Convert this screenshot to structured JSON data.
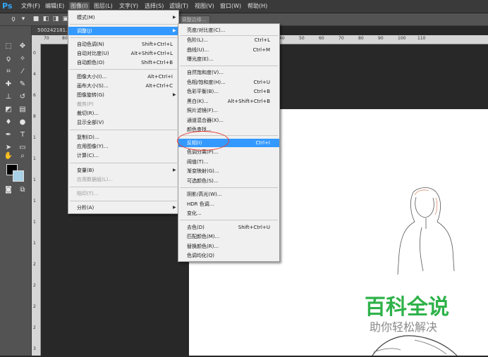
{
  "app": {
    "logo": "Ps"
  },
  "menubar": [
    {
      "label": "文件(F)",
      "active": false
    },
    {
      "label": "编辑(E)",
      "active": false
    },
    {
      "label": "图像(I)",
      "active": true
    },
    {
      "label": "图层(L)",
      "active": false
    },
    {
      "label": "文字(Y)",
      "active": false
    },
    {
      "label": "选择(S)",
      "active": false
    },
    {
      "label": "滤镜(T)",
      "active": false
    },
    {
      "label": "视图(V)",
      "active": false
    },
    {
      "label": "窗口(W)",
      "active": false
    },
    {
      "label": "帮助(H)",
      "active": false
    }
  ],
  "optionsbar": {
    "refine_edge_label": "调整边缘..."
  },
  "document": {
    "tab_label": "500242181..."
  },
  "ruler": {
    "h_labels": [
      "70",
      "80",
      "40",
      "50",
      "60",
      "70",
      "80",
      "90",
      "100",
      "110"
    ],
    "v_labels": [
      "0",
      "4",
      "6",
      "8",
      "1",
      "1",
      "1",
      "1",
      "1",
      "1",
      "2",
      "2",
      "2",
      "2",
      "3"
    ]
  },
  "image_menu": {
    "items": [
      {
        "label": "模式(M)",
        "shortcut": "",
        "submenu": true,
        "disabled": false,
        "highlight": false
      },
      {
        "label": "调整(J)",
        "shortcut": "",
        "submenu": true,
        "disabled": false,
        "highlight": true
      },
      {
        "label": "自动色调(N)",
        "shortcut": "Shift+Ctrl+L",
        "submenu": false,
        "disabled": false,
        "highlight": false
      },
      {
        "label": "自动对比度(U)",
        "shortcut": "Alt+Shift+Ctrl+L",
        "submenu": false,
        "disabled": false,
        "highlight": false
      },
      {
        "label": "自动颜色(O)",
        "shortcut": "Shift+Ctrl+B",
        "submenu": false,
        "disabled": false,
        "highlight": false
      },
      {
        "label": "图像大小(I)...",
        "shortcut": "Alt+Ctrl+I",
        "submenu": false,
        "disabled": false,
        "highlight": false
      },
      {
        "label": "画布大小(S)...",
        "shortcut": "Alt+Ctrl+C",
        "submenu": false,
        "disabled": false,
        "highlight": false
      },
      {
        "label": "图像旋转(G)",
        "shortcut": "",
        "submenu": true,
        "disabled": false,
        "highlight": false
      },
      {
        "label": "裁剪(P)",
        "shortcut": "",
        "submenu": false,
        "disabled": true,
        "highlight": false
      },
      {
        "label": "裁切(R)...",
        "shortcut": "",
        "submenu": false,
        "disabled": false,
        "highlight": false
      },
      {
        "label": "显示全部(V)",
        "shortcut": "",
        "submenu": false,
        "disabled": false,
        "highlight": false
      },
      {
        "label": "复制(D)...",
        "shortcut": "",
        "submenu": false,
        "disabled": false,
        "highlight": false
      },
      {
        "label": "应用图像(Y)...",
        "shortcut": "",
        "submenu": false,
        "disabled": false,
        "highlight": false
      },
      {
        "label": "计算(C)...",
        "shortcut": "",
        "submenu": false,
        "disabled": false,
        "highlight": false
      },
      {
        "label": "变量(B)",
        "shortcut": "",
        "submenu": true,
        "disabled": false,
        "highlight": false
      },
      {
        "label": "应用数据组(L)...",
        "shortcut": "",
        "submenu": false,
        "disabled": true,
        "highlight": false
      },
      {
        "label": "陷印(T)...",
        "shortcut": "",
        "submenu": false,
        "disabled": true,
        "highlight": false
      },
      {
        "label": "分析(A)",
        "shortcut": "",
        "submenu": true,
        "disabled": false,
        "highlight": false
      }
    ]
  },
  "adjust_menu": {
    "items": [
      {
        "label": "亮度/对比度(C)...",
        "shortcut": "",
        "highlight": false
      },
      {
        "label": "色阶(L)...",
        "shortcut": "Ctrl+L",
        "highlight": false
      },
      {
        "label": "曲线(U)...",
        "shortcut": "Ctrl+M",
        "highlight": false
      },
      {
        "label": "曝光度(E)...",
        "shortcut": "",
        "highlight": false
      },
      {
        "label": "自然饱和度(V)...",
        "shortcut": "",
        "highlight": false
      },
      {
        "label": "色相/饱和度(H)...",
        "shortcut": "Ctrl+U",
        "highlight": false
      },
      {
        "label": "色彩平衡(B)...",
        "shortcut": "Ctrl+B",
        "highlight": false
      },
      {
        "label": "黑白(K)...",
        "shortcut": "Alt+Shift+Ctrl+B",
        "highlight": false
      },
      {
        "label": "照片滤镜(F)...",
        "shortcut": "",
        "highlight": false
      },
      {
        "label": "通道混合器(X)...",
        "shortcut": "",
        "highlight": false
      },
      {
        "label": "颜色查找...",
        "shortcut": "",
        "highlight": false
      },
      {
        "label": "反相(I)",
        "shortcut": "Ctrl+I",
        "highlight": true
      },
      {
        "label": "色调分离(P)...",
        "shortcut": "",
        "highlight": false
      },
      {
        "label": "阈值(T)...",
        "shortcut": "",
        "highlight": false
      },
      {
        "label": "渐变映射(G)...",
        "shortcut": "",
        "highlight": false
      },
      {
        "label": "可选颜色(S)...",
        "shortcut": "",
        "highlight": false
      },
      {
        "label": "阴影/高光(W)...",
        "shortcut": "",
        "highlight": false
      },
      {
        "label": "HDR 色调...",
        "shortcut": "",
        "highlight": false
      },
      {
        "label": "变化...",
        "shortcut": "",
        "highlight": false
      },
      {
        "label": "去色(D)",
        "shortcut": "Shift+Ctrl+U",
        "highlight": false
      },
      {
        "label": "匹配颜色(M)...",
        "shortcut": "",
        "highlight": false
      },
      {
        "label": "替换颜色(R)...",
        "shortcut": "",
        "highlight": false
      },
      {
        "label": "色调均化(Q)",
        "shortcut": "",
        "highlight": false
      }
    ]
  },
  "watermark": {
    "title": "百科全说",
    "subtitle": "助你轻松解决"
  },
  "colors": {
    "accent": "#3399ff",
    "highlight_ring": "#e53935",
    "watermark_green": "#2fb24a",
    "ps_blue": "#31a8ff"
  },
  "icons": [
    "lasso-icon",
    "move-icon",
    "marquee-icon",
    "magic-wand-icon",
    "crop-icon",
    "eyedropper-icon",
    "healing-brush-icon",
    "brush-icon",
    "clone-stamp-icon",
    "history-brush-icon",
    "eraser-icon",
    "gradient-icon",
    "blur-icon",
    "dodge-icon",
    "pen-icon",
    "type-icon",
    "path-select-icon",
    "shape-icon",
    "hand-icon",
    "zoom-icon",
    "quick-mask-icon",
    "screen-mode-icon"
  ]
}
